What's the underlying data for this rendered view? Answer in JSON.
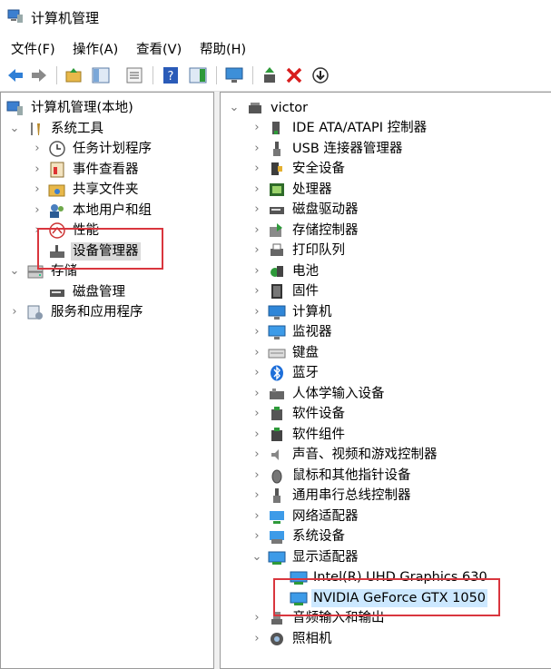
{
  "window": {
    "title": "计算机管理"
  },
  "menu": [
    "文件(F)",
    "操作(A)",
    "查看(V)",
    "帮助(H)"
  ],
  "toolbar": [
    "back-icon",
    "forward-icon",
    "up-folder-icon",
    "show-hide-tree-icon",
    "properties-icon",
    "help-icon",
    "action-pane-icon",
    "monitor-icon",
    "update-driver-icon",
    "uninstall-icon",
    "download-icon"
  ],
  "left_tree": {
    "root": "计算机管理(本地)",
    "system_tools": "系统工具",
    "task_scheduler": "任务计划程序",
    "event_viewer": "事件查看器",
    "shared_folders": "共享文件夹",
    "local_users": "本地用户和组",
    "performance": "性能",
    "device_manager": "设备管理器",
    "storage": "存储",
    "disk_management": "磁盘管理",
    "services": "服务和应用程序"
  },
  "right_tree": {
    "root": "victor",
    "categories": [
      "IDE ATA/ATAPI 控制器",
      "USB 连接器管理器",
      "安全设备",
      "处理器",
      "磁盘驱动器",
      "存储控制器",
      "打印队列",
      "电池",
      "固件",
      "计算机",
      "监视器",
      "键盘",
      "蓝牙",
      "人体学输入设备",
      "软件设备",
      "软件组件",
      "声音、视频和游戏控制器",
      "鼠标和其他指针设备",
      "通用串行总线控制器",
      "网络适配器",
      "系统设备",
      "显示适配器"
    ],
    "display_children": [
      "Intel(R) UHD Graphics 630",
      "NVIDIA GeForce GTX 1050"
    ],
    "after": [
      "音频输入和输出",
      "照相机"
    ]
  },
  "colors": {
    "highlight": "#d9363e",
    "selection": "#cce8ff",
    "accent": "#1e6fd9"
  }
}
